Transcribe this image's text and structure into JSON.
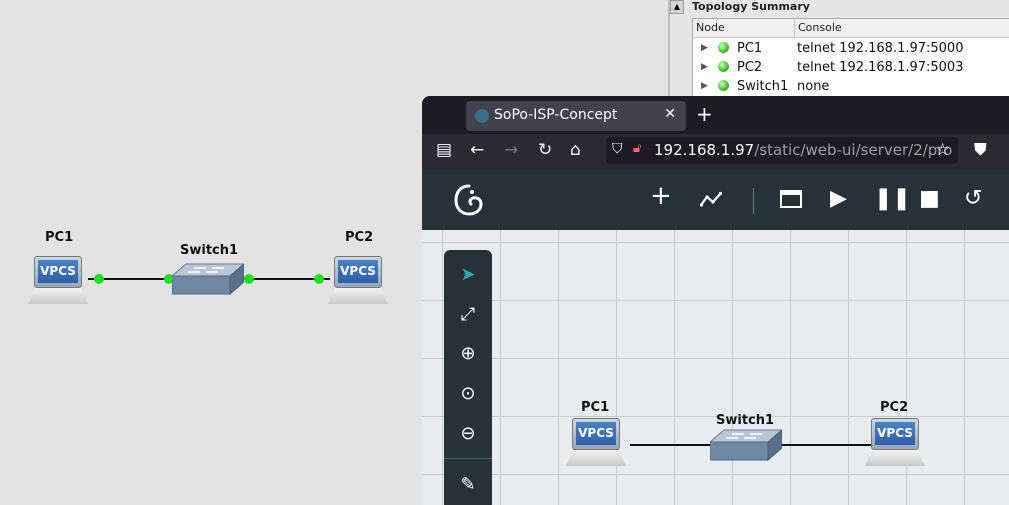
{
  "canvas": {
    "nodes": {
      "pc1": {
        "label": "PC1",
        "icon_text": "VPCS"
      },
      "switch1": {
        "label": "Switch1"
      },
      "pc2": {
        "label": "PC2",
        "icon_text": "VPCS"
      }
    },
    "link_status_color": "#1ee01e"
  },
  "topology": {
    "title": "Topology Summary",
    "columns": [
      "Node",
      "Console"
    ],
    "rows": [
      {
        "node": "PC1",
        "console": "telnet 192.168.1.97:5000"
      },
      {
        "node": "PC2",
        "console": "telnet 192.168.1.97:5003"
      },
      {
        "node": "Switch1",
        "console": "none"
      }
    ]
  },
  "browser": {
    "tab_title": "SoPo-ISP-Concept",
    "url_host": "192.168.1.97",
    "url_path": "/static/web-ui/server/2/pro",
    "app": {
      "nodes": {
        "pc1": {
          "label": "PC1",
          "icon_text": "VPCS"
        },
        "switch1": {
          "label": "Switch1"
        },
        "pc2": {
          "label": "PC2",
          "icon_text": "VPCS"
        }
      }
    }
  },
  "colors": {
    "appbar": "#263238",
    "accent": "#2fa8b4",
    "browser_chrome": "#2b2a33"
  }
}
